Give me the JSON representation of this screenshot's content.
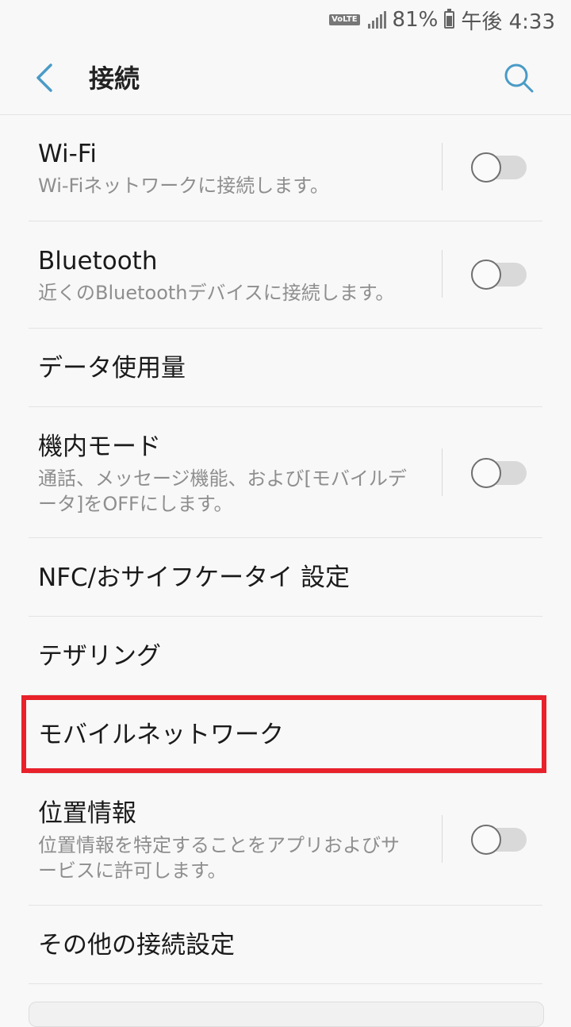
{
  "status": {
    "volte": "VoLTE",
    "battery": "81%",
    "time": "午後 4:33"
  },
  "header": {
    "title": "接続"
  },
  "icons": {
    "back": "chevron-left-icon",
    "search": "search-icon",
    "accent": "#4a9bc7"
  },
  "items": [
    {
      "label": "Wi-Fi",
      "sub": "Wi-Fiネットワークに接続します。",
      "toggle": "off"
    },
    {
      "label": "Bluetooth",
      "sub": "近くのBluetoothデバイスに接続します。",
      "toggle": "off"
    },
    {
      "label": "データ使用量"
    },
    {
      "label": "機内モード",
      "sub": "通話、メッセージ機能、および[モバイルデータ]をOFFにします。",
      "toggle": "off"
    },
    {
      "label": "NFC/おサイフケータイ 設定"
    },
    {
      "label": "テザリング"
    },
    {
      "label": "モバイルネットワーク",
      "highlighted": true
    },
    {
      "label": "位置情報",
      "sub": "位置情報を特定することをアプリおよびサービスに許可します。",
      "toggle": "off"
    },
    {
      "label": "その他の接続設定"
    }
  ],
  "highlight_color": "#e8212b"
}
